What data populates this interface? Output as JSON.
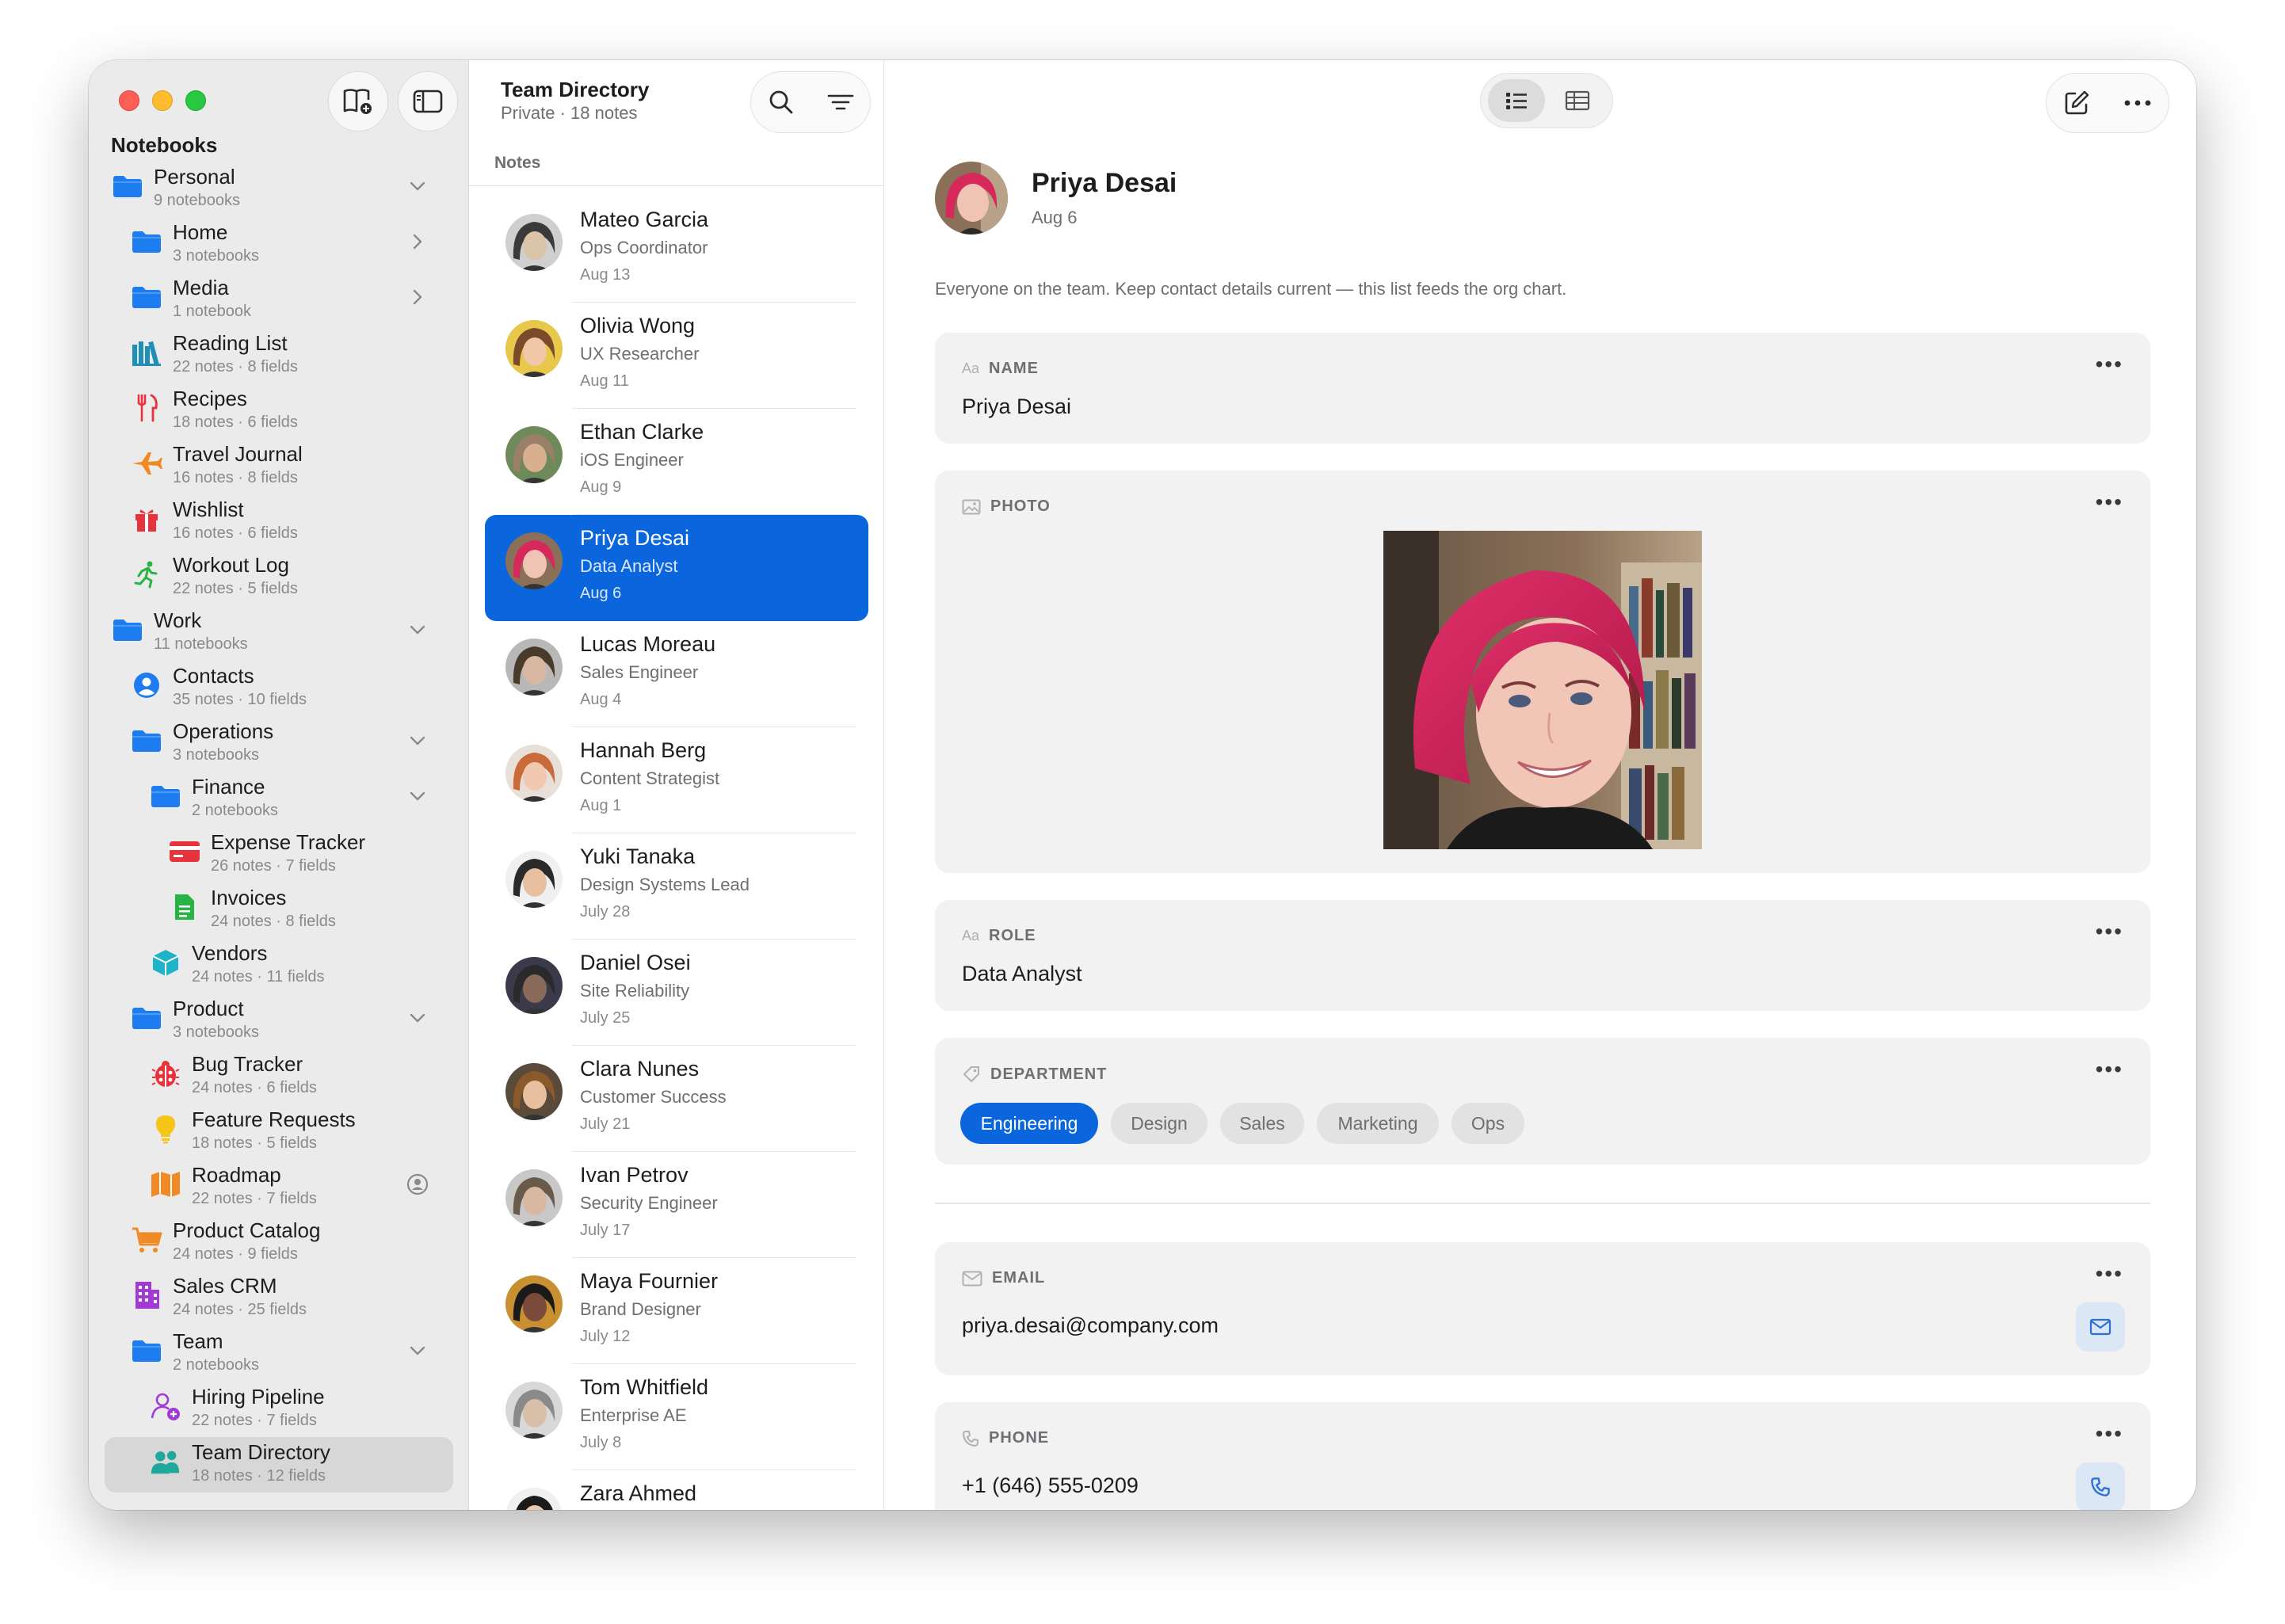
{
  "sidebar": {
    "title": "Notebooks",
    "items": [
      {
        "name": "Personal",
        "sub": "9 notebooks",
        "icon": "folder-icon",
        "indent": 0,
        "chev": "down"
      },
      {
        "name": "Home",
        "sub": "3 notebooks",
        "icon": "folder-icon",
        "indent": 1,
        "chev": "right"
      },
      {
        "name": "Media",
        "sub": "1 notebook",
        "icon": "folder-icon",
        "indent": 1,
        "chev": "right"
      },
      {
        "name": "Reading List",
        "sub": "22 notes · 8 fields",
        "icon": "books-icon",
        "indent": 1
      },
      {
        "name": "Recipes",
        "sub": "18 notes · 6 fields",
        "icon": "fork-knife-icon",
        "indent": 1
      },
      {
        "name": "Travel Journal",
        "sub": "16 notes · 8 fields",
        "icon": "airplane-icon",
        "indent": 1
      },
      {
        "name": "Wishlist",
        "sub": "16 notes · 6 fields",
        "icon": "gift-icon",
        "indent": 1
      },
      {
        "name": "Workout Log",
        "sub": "22 notes · 5 fields",
        "icon": "runner-icon",
        "indent": 1
      },
      {
        "name": "Work",
        "sub": "11 notebooks",
        "icon": "folder-icon",
        "indent": 0,
        "chev": "down"
      },
      {
        "name": "Contacts",
        "sub": "35 notes · 10 fields",
        "icon": "person-circle-icon",
        "indent": 1
      },
      {
        "name": "Operations",
        "sub": "3 notebooks",
        "icon": "folder-icon",
        "indent": 1,
        "chev": "down"
      },
      {
        "name": "Finance",
        "sub": "2 notebooks",
        "icon": "folder-icon",
        "indent": 2,
        "chev": "down"
      },
      {
        "name": "Expense Tracker",
        "sub": "26 notes · 7 fields",
        "icon": "credit-card-icon",
        "indent": 3
      },
      {
        "name": "Invoices",
        "sub": "24 notes · 8 fields",
        "icon": "document-icon",
        "indent": 3
      },
      {
        "name": "Vendors",
        "sub": "24 notes · 11 fields",
        "icon": "box-icon",
        "indent": 2
      },
      {
        "name": "Product",
        "sub": "3 notebooks",
        "icon": "folder-icon",
        "indent": 1,
        "chev": "down"
      },
      {
        "name": "Bug Tracker",
        "sub": "24 notes · 6 fields",
        "icon": "ladybug-icon",
        "indent": 2
      },
      {
        "name": "Feature Requests",
        "sub": "18 notes · 5 fields",
        "icon": "lightbulb-icon",
        "indent": 2
      },
      {
        "name": "Roadmap",
        "sub": "22 notes · 7 fields",
        "icon": "map-icon",
        "indent": 2,
        "shared": true
      },
      {
        "name": "Product Catalog",
        "sub": "24 notes · 9 fields",
        "icon": "cart-icon",
        "indent": 1
      },
      {
        "name": "Sales CRM",
        "sub": "24 notes · 25 fields",
        "icon": "building-icon",
        "indent": 1
      },
      {
        "name": "Team",
        "sub": "2 notebooks",
        "icon": "folder-icon",
        "indent": 1,
        "chev": "down"
      },
      {
        "name": "Hiring Pipeline",
        "sub": "22 notes · 7 fields",
        "icon": "person-add-icon",
        "indent": 2
      },
      {
        "name": "Team Directory",
        "sub": "18 notes · 12 fields",
        "icon": "people-icon",
        "indent": 2,
        "selected": true
      }
    ]
  },
  "list": {
    "title": "Team Directory",
    "subtitle": "Private · 18 notes",
    "header": "Notes",
    "rows": [
      {
        "name": "Mateo Garcia",
        "role": "Ops Coordinator",
        "date": "Aug 13",
        "skin": "#d9c4a8",
        "hair": "#3a3a3a",
        "bg": "#cfcfcf"
      },
      {
        "name": "Olivia Wong",
        "role": "UX Researcher",
        "date": "Aug 11",
        "skin": "#f0c8a8",
        "hair": "#7a4a2a",
        "bg": "#e8c84a"
      },
      {
        "name": "Ethan Clarke",
        "role": "iOS Engineer",
        "date": "Aug 9",
        "skin": "#d8b090",
        "hair": "#9a8068",
        "bg": "#6f8a5a"
      },
      {
        "name": "Priya Desai",
        "role": "Data Analyst",
        "date": "Aug 6",
        "skin": "#f0c4b4",
        "hair": "#d6285a",
        "bg": "#8a7058",
        "selected": true
      },
      {
        "name": "Lucas Moreau",
        "role": "Sales Engineer",
        "date": "Aug 4",
        "skin": "#d8b8a0",
        "hair": "#4a3a2a",
        "bg": "#b8b8b8"
      },
      {
        "name": "Hannah Berg",
        "role": "Content Strategist",
        "date": "Aug 1",
        "skin": "#f2c8b0",
        "hair": "#c86a3a",
        "bg": "#e8e0d8"
      },
      {
        "name": "Yuki Tanaka",
        "role": "Design Systems Lead",
        "date": "July 28",
        "skin": "#e8c0a0",
        "hair": "#2a2a2a",
        "bg": "#f0f0f0"
      },
      {
        "name": "Daniel Osei",
        "role": "Site Reliability",
        "date": "July 25",
        "skin": "#8a6a5a",
        "hair": "#2a2a2a",
        "bg": "#3a3a4a"
      },
      {
        "name": "Clara Nunes",
        "role": "Customer Success",
        "date": "July 21",
        "skin": "#e8c0a0",
        "hair": "#8a5a2a",
        "bg": "#5a4a3a"
      },
      {
        "name": "Ivan Petrov",
        "role": "Security Engineer",
        "date": "July 17",
        "skin": "#d8b8a0",
        "hair": "#6a5a4a",
        "bg": "#c8c8c8"
      },
      {
        "name": "Maya Fournier",
        "role": "Brand Designer",
        "date": "July 12",
        "skin": "#7a4a3a",
        "hair": "#1a1a1a",
        "bg": "#c89030"
      },
      {
        "name": "Tom Whitfield",
        "role": "Enterprise AE",
        "date": "July 8",
        "skin": "#d8c0a8",
        "hair": "#8a8a8a",
        "bg": "#d8d8d8"
      },
      {
        "name": "Zara Ahmed",
        "role": "",
        "date": "",
        "skin": "#e8c8b0",
        "hair": "#1a1a1a",
        "bg": "#f0f0f0"
      }
    ]
  },
  "detail": {
    "name": "Priya Desai",
    "date": "Aug 6",
    "description": "Everyone on the team. Keep contact details current — this list feeds the org chart.",
    "fields": {
      "name_label": "NAME",
      "name_value": "Priya Desai",
      "photo_label": "PHOTO",
      "role_label": "ROLE",
      "role_value": "Data Analyst",
      "department_label": "DEPARTMENT",
      "departments": [
        "Engineering",
        "Design",
        "Sales",
        "Marketing",
        "Ops"
      ],
      "department_selected": "Engineering",
      "email_label": "EMAIL",
      "email_value": "priya.desai@company.com",
      "phone_label": "PHONE",
      "phone_value": "+1 (646) 555-0209"
    },
    "text_icon": "Aa"
  },
  "colors": {
    "accent": "#0b66de",
    "folder": "#1c7cf0"
  }
}
